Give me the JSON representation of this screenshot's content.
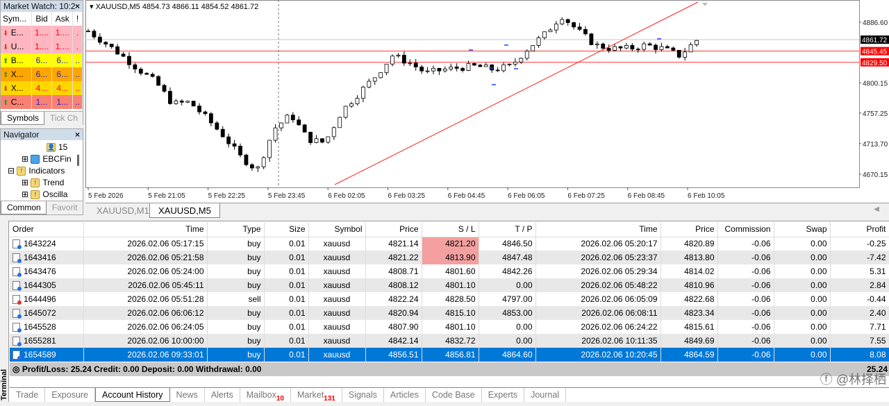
{
  "market_watch": {
    "title": "Market Watch: 10:2",
    "columns": [
      "Sym...",
      "Bid",
      "Ask",
      "!"
    ],
    "rows": [
      {
        "symbol": "E...",
        "bid": "1....",
        "ask": "1....",
        "flag": ".",
        "dir": "down",
        "bg": "#ffb6c1",
        "color": "#ff0000"
      },
      {
        "symbol": "U...",
        "bid": "1....",
        "ask": "1....",
        "flag": ".",
        "dir": "down",
        "bg": "#ffb6c1",
        "color": "#ff0000"
      },
      {
        "symbol": "B...",
        "bid": "6...",
        "ask": "6...",
        "flag": "..",
        "dir": "up",
        "bg": "#ffff00",
        "color": "#1e1ecc"
      },
      {
        "symbol": "X...",
        "bid": "6...",
        "ask": "6...",
        "flag": "..",
        "dir": "up",
        "bg": "#ffa500",
        "color": "#1e1ecc"
      },
      {
        "symbol": "X...",
        "bid": "4...",
        "ask": "4...",
        "flag": "..",
        "dir": "down",
        "bg": "#ffd700",
        "color": "#ff0000"
      },
      {
        "symbol": "C...",
        "bid": "1...",
        "ask": "1...",
        "flag": "..",
        "dir": "up",
        "bg": "#fa8072",
        "color": "#1e1ecc"
      }
    ],
    "tabs": [
      "Symbols",
      "Tick Ch"
    ]
  },
  "navigator": {
    "title": "Navigator",
    "items": [
      "15",
      "EBCFin",
      "Indicators",
      "Trend",
      "Oscilla"
    ],
    "tabs": [
      "Common",
      "Favorit"
    ]
  },
  "chart": {
    "header": "XAUUSD,M5  4854.73 4866.11 4854.52 4861.72",
    "price_ticks": [
      "4886.60",
      "4800.15",
      "4757.25",
      "4713.70",
      "4670.15"
    ],
    "price_labels": [
      {
        "text": "4861.72",
        "bg": "#000000"
      },
      {
        "text": "4845.45",
        "bg": "#ff0000"
      },
      {
        "text": "4829.50",
        "bg": "#ff0000"
      }
    ],
    "time_ticks": [
      "5 Feb 2026",
      "5 Feb 21:05",
      "5 Feb 22:25",
      "5 Feb 23:45",
      "6 Feb 02:05",
      "6 Feb 03:25",
      "6 Feb 04:45",
      "6 Feb 06:05",
      "6 Feb 07:25",
      "6 Feb 08:45",
      "6 Feb 10:05"
    ],
    "closes": [
      4874,
      4857,
      4839,
      4819,
      4801,
      4770,
      4773,
      4750,
      4725,
      4695,
      4676,
      4735,
      4755,
      4720,
      4715,
      4760,
      4785,
      4810,
      4839,
      4829,
      4814,
      4819,
      4822,
      4824,
      4819,
      4824,
      4849,
      4869,
      4896,
      4874,
      4854,
      4849,
      4849,
      4854,
      4849,
      4839,
      4861
    ],
    "tabs": [
      "XAUUSD,M1",
      "XAUUSD,M5"
    ]
  },
  "terminal": {
    "label": "Terminal",
    "columns": [
      "Order",
      "Time",
      "Type",
      "Size",
      "Symbol",
      "Price",
      "S / L",
      "T / P",
      "Time",
      "Price",
      "Commission",
      "Swap",
      "Profit"
    ],
    "rows": [
      [
        "1643224",
        "2026.02.06 05:17:15",
        "buy",
        "0.01",
        "xauusd",
        "4821.14",
        "4821.20",
        "4846.50",
        "2026.02.06 05:20:17",
        "4820.89",
        "-0.06",
        "0.00",
        "-0.25"
      ],
      [
        "1643416",
        "2026.02.06 05:21:58",
        "buy",
        "0.01",
        "xauusd",
        "4821.22",
        "4813.90",
        "4847.48",
        "2026.02.06 05:23:37",
        "4813.80",
        "-0.06",
        "0.00",
        "-7.42"
      ],
      [
        "1643476",
        "2026.02.06 05:24:00",
        "buy",
        "0.01",
        "xauusd",
        "4808.71",
        "4801.60",
        "4842.26",
        "2026.02.06 05:29:34",
        "4814.02",
        "-0.06",
        "0.00",
        "5.31"
      ],
      [
        "1644305",
        "2026.02.06 05:45:11",
        "buy",
        "0.01",
        "xauusd",
        "4808.12",
        "4801.10",
        "0.00",
        "2026.02.06 05:48:22",
        "4810.96",
        "-0.06",
        "0.00",
        "2.84"
      ],
      [
        "1644496",
        "2026.02.06 05:51:28",
        "sell",
        "0.01",
        "xauusd",
        "4822.24",
        "4828.50",
        "4797.00",
        "2026.02.06 06:05:09",
        "4822.68",
        "-0.06",
        "0.00",
        "-0.44"
      ],
      [
        "1645072",
        "2026.02.06 06:06:12",
        "buy",
        "0.01",
        "xauusd",
        "4820.94",
        "4815.10",
        "4853.00",
        "2026.02.06 06:08:11",
        "4823.34",
        "-0.06",
        "0.00",
        "2.40"
      ],
      [
        "1645528",
        "2026.02.06 06:24:05",
        "buy",
        "0.01",
        "xauusd",
        "4807.90",
        "4801.10",
        "0.00",
        "2026.02.06 06:24:22",
        "4815.61",
        "-0.06",
        "0.00",
        "7.71"
      ],
      [
        "1655281",
        "2026.02.06 10:00:00",
        "buy",
        "0.01",
        "xauusd",
        "4842.14",
        "4832.72",
        "0.00",
        "2026.02.06 10:11:35",
        "4849.69",
        "-0.06",
        "0.00",
        "7.55"
      ],
      [
        "1654589",
        "2026.02.06 09:33:01",
        "buy",
        "0.01",
        "xauusd",
        "4856.51",
        "4856.81",
        "4864.60",
        "2026.02.06 10:20:45",
        "4864.59",
        "-0.06",
        "0.00",
        "8.08"
      ]
    ],
    "highlighted_sl_rows": [
      0,
      1
    ],
    "selected_row": 8,
    "summary": "Profit/Loss: 25.24  Credit: 0.00  Deposit: 0.00  Withdrawal: 0.00",
    "total": "25.24",
    "tabs": [
      {
        "label": "Trade"
      },
      {
        "label": "Exposure"
      },
      {
        "label": "Account History",
        "active": true
      },
      {
        "label": "News"
      },
      {
        "label": "Alerts"
      },
      {
        "label": "Mailbox",
        "badge": "10"
      },
      {
        "label": "Market",
        "badge": "131"
      },
      {
        "label": "Signals"
      },
      {
        "label": "Articles"
      },
      {
        "label": "Code Base"
      },
      {
        "label": "Experts"
      },
      {
        "label": "Journal"
      }
    ]
  },
  "watermark": "@林择栖"
}
